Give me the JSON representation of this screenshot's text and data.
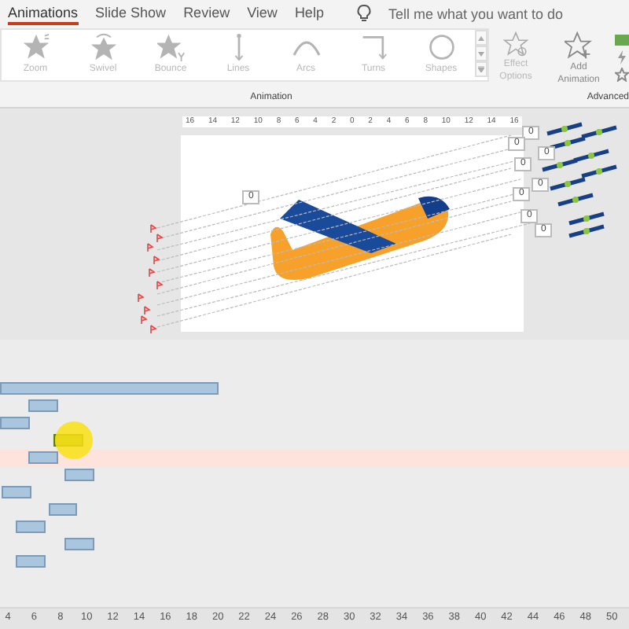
{
  "tabs": [
    {
      "label": "Animations",
      "selected": true
    },
    {
      "label": "Slide Show",
      "selected": false
    },
    {
      "label": "Review",
      "selected": false
    },
    {
      "label": "View",
      "selected": false
    },
    {
      "label": "Help",
      "selected": false
    }
  ],
  "tell_me": {
    "placeholder": "Tell me what you want to do"
  },
  "animation_gallery": [
    {
      "label": "Zoom",
      "kind": "zoom",
      "disabled": true
    },
    {
      "label": "Swivel",
      "kind": "swivel",
      "disabled": true
    },
    {
      "label": "Bounce",
      "kind": "bounce",
      "disabled": true
    },
    {
      "label": "Lines",
      "kind": "lines",
      "disabled": true
    },
    {
      "label": "Arcs",
      "kind": "arcs",
      "disabled": true
    },
    {
      "label": "Turns",
      "kind": "turns",
      "disabled": true
    },
    {
      "label": "Shapes",
      "kind": "shapes",
      "disabled": true
    }
  ],
  "effect_options": {
    "label": "Effect Options",
    "disabled": true
  },
  "add_animation": {
    "label": "Add Animation"
  },
  "group_labels": [
    "Animation",
    "Advanced"
  ],
  "ruler": [
    "16",
    "14",
    "12",
    "10",
    "8",
    "6",
    "4",
    "2",
    "0",
    "2",
    "4",
    "6",
    "8",
    "10",
    "12",
    "14",
    "16"
  ],
  "path_values": [
    "0",
    "0",
    "0",
    "0",
    "0",
    "0",
    "0",
    "0",
    "0"
  ],
  "timeline": {
    "rows": [
      {
        "selected": false,
        "hovered": false
      },
      {
        "selected": false,
        "hovered": false
      },
      {
        "selected": false,
        "hovered": false
      },
      {
        "selected": true,
        "hovered": false
      },
      {
        "selected": false,
        "hovered": true
      },
      {
        "selected": false,
        "hovered": false
      },
      {
        "selected": false,
        "hovered": false
      },
      {
        "selected": false,
        "hovered": false
      },
      {
        "selected": false,
        "hovered": false
      },
      {
        "selected": false,
        "hovered": false
      },
      {
        "selected": false,
        "hovered": false
      }
    ],
    "ticks": [
      "4",
      "6",
      "8",
      "10",
      "12",
      "14",
      "16",
      "18",
      "20",
      "22",
      "24",
      "26",
      "28",
      "30",
      "32",
      "34",
      "36",
      "38",
      "40",
      "42",
      "44",
      "46",
      "48",
      "50"
    ]
  }
}
